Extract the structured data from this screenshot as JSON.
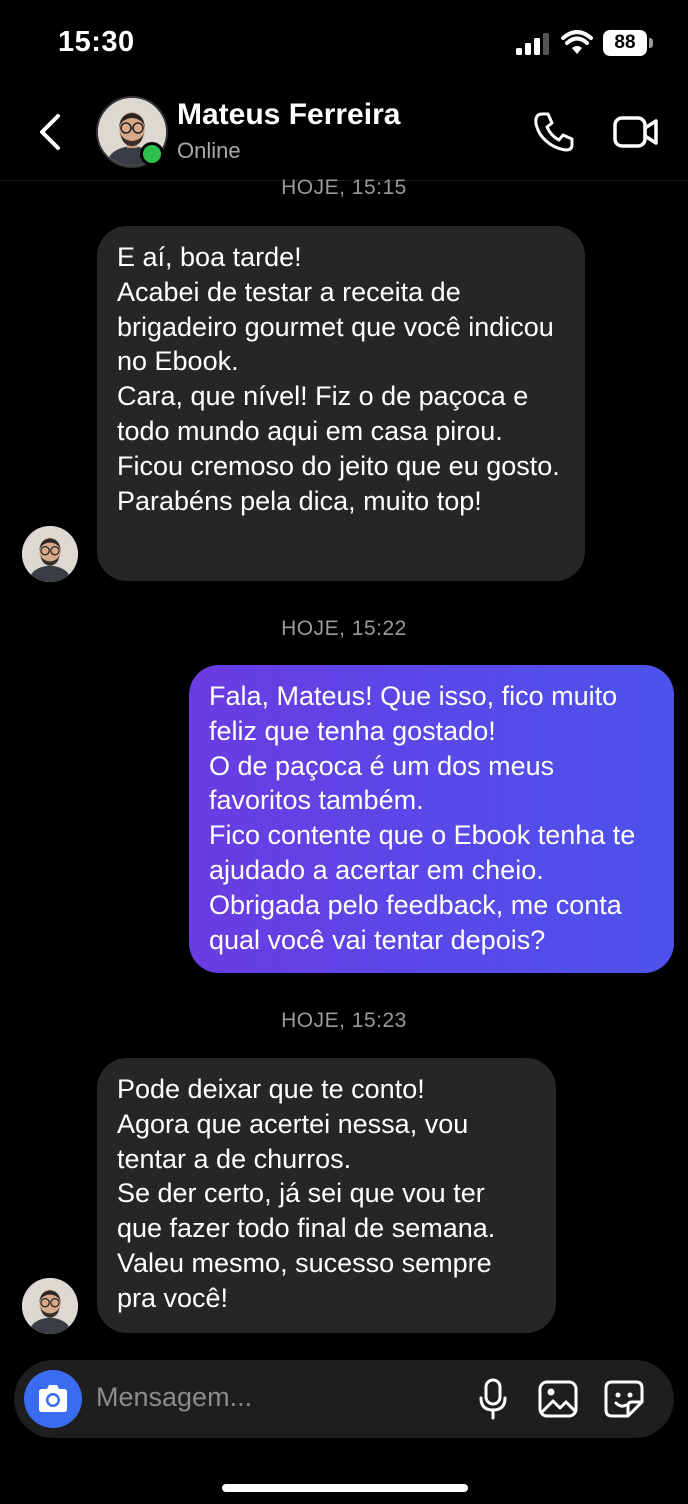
{
  "status_bar": {
    "time": "15:30",
    "battery": "88"
  },
  "header": {
    "contact_name": "Mateus Ferreira",
    "contact_status": "Online"
  },
  "messages": [
    {
      "timestamp": "HOJE, 15:15",
      "direction": "incoming",
      "text": "E aí, boa tarde!\nAcabei de testar a receita de brigadeiro gourmet que você indicou no Ebook.\nCara, que nível! Fiz o de paçoca e todo mundo aqui em casa pirou.\nFicou cremoso do jeito que eu gosto. Parabéns pela dica, muito top!"
    },
    {
      "timestamp": "HOJE, 15:22",
      "direction": "outgoing",
      "text": "Fala, Mateus! Que isso, fico muito feliz que tenha gostado!\nO de paçoca é um dos meus favoritos também.\nFico contente que o Ebook tenha te ajudado a acertar em cheio.\nObrigada pelo feedback, me conta qual você vai tentar depois?"
    },
    {
      "timestamp": "HOJE, 15:23",
      "direction": "incoming",
      "text": "Pode deixar que te conto!\nAgora que acertei nessa, vou tentar a de churros.\nSe der certo, já sei que vou ter que fazer todo final de semana.\nValeu mesmo, sucesso sempre pra você!"
    }
  ],
  "composer": {
    "placeholder": "Mensagem..."
  },
  "colors": {
    "incoming_bubble": "#262626",
    "outgoing_gradient_start": "#6a3ce2",
    "outgoing_gradient_end": "#4d52ec",
    "online": "#2ec04f",
    "camera_button": "#3a6cf0"
  }
}
